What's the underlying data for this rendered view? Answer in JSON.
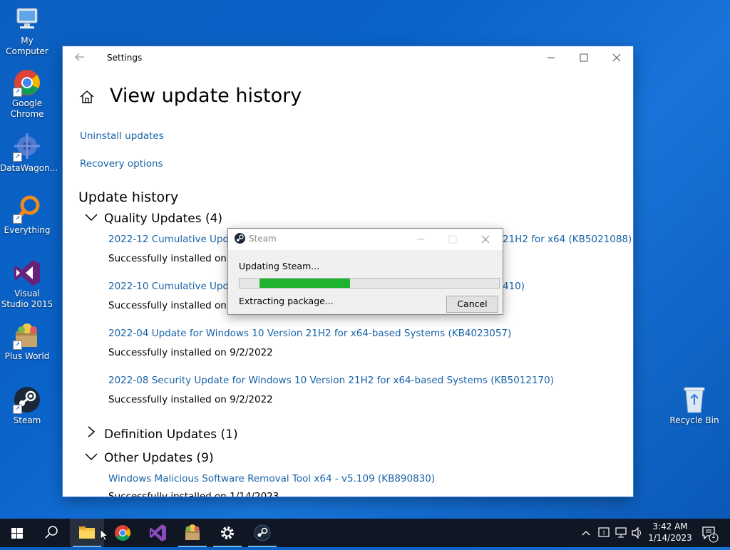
{
  "desktop": {
    "icons": [
      {
        "label": "My Computer"
      },
      {
        "label": "Google Chrome"
      },
      {
        "label": "DataWagon..."
      },
      {
        "label": "Everything"
      },
      {
        "label": "Visual Studio 2015"
      },
      {
        "label": "Plus World"
      },
      {
        "label": "Steam"
      },
      {
        "label": "Recycle Bin"
      }
    ]
  },
  "settings": {
    "window_title": "Settings",
    "page_title": "View update history",
    "links": {
      "uninstall": "Uninstall updates",
      "recovery": "Recovery options"
    },
    "section_title": "Update history",
    "groups": {
      "quality": "Quality Updates (4)",
      "definition": "Definition Updates (1)",
      "other": "Other Updates (9)"
    },
    "updates": [
      {
        "title": "2022-12 Cumulative Update for Windows 10 Version 21H2 for x64 (KB5021088)",
        "title_left": "2022-12 Cumulative Update",
        "title_right": "21H2 for x64 (KB5021088)",
        "status": "Successfully installed on 12/",
        "status_full": "Successfully installed on 12/"
      },
      {
        "title_left": "2022-10 Cumulative Update",
        "title_right": "410)",
        "status": "Successfully installed on 10/"
      },
      {
        "title": "2022-04 Update for Windows 10 Version 21H2 for x64-based Systems (KB4023057)",
        "status": "Successfully installed on 9/2/2022"
      },
      {
        "title": "2022-08 Security Update for Windows 10 Version 21H2 for x64-based Systems (KB5012170)",
        "status": "Successfully installed on 9/2/2022"
      },
      {
        "title": "Windows Malicious Software Removal Tool x64 - v5.109 (KB890830)",
        "status": "Successfully installed on 1/14/2023"
      }
    ]
  },
  "steam_dialog": {
    "title": "Steam",
    "status_top": "Updating Steam...",
    "status_bottom": "Extracting package...",
    "progress": 0.35,
    "cancel_label": "Cancel"
  },
  "taskbar": {
    "time": "3:42 AM",
    "date": "1/14/2023",
    "notification_count": "1",
    "pinned": [
      "start-icon",
      "search-icon",
      "file-explorer-icon",
      "chrome-icon",
      "visual-studio-icon",
      "plus-world-icon",
      "settings-gear-icon",
      "steam-icon"
    ]
  },
  "colors": {
    "link": "#1863a8",
    "progress_fill": "#1fb32d",
    "desktop_bg": "#0a63c9",
    "taskbar_bg": "#101623"
  }
}
